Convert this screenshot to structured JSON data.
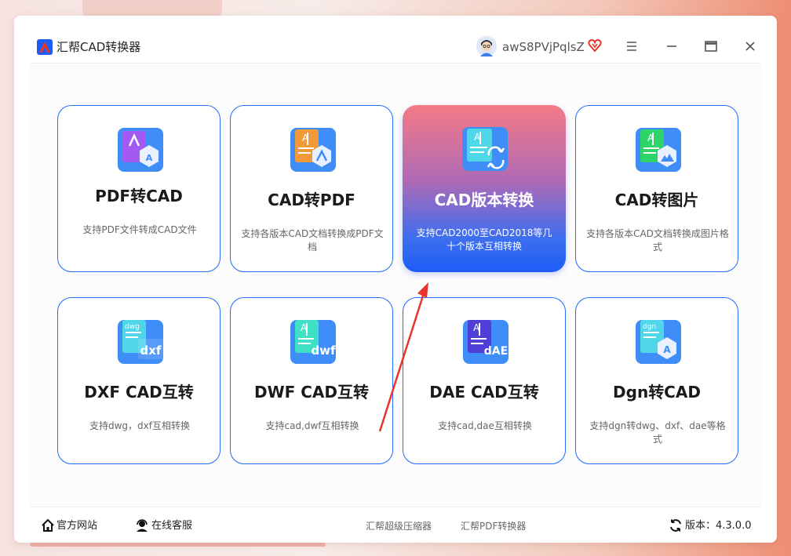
{
  "window": {
    "title": "汇帮CAD转换器"
  },
  "user": {
    "name": "awS8PVjPqlsZ"
  },
  "cards": [
    {
      "title": "PDF转CAD",
      "desc": "支持PDF文件转成CAD文件"
    },
    {
      "title": "CAD转PDF",
      "desc": "支持各版本CAD文档转换成PDF文档"
    },
    {
      "title": "CAD版本转换",
      "desc": "支持CAD2000至CAD2018等几十个版本互相转换"
    },
    {
      "title": "CAD转图片",
      "desc": "支持各版本CAD文档转换成图片格式"
    },
    {
      "title": "DXF CAD互转",
      "desc": "支持dwg，dxf互相转换"
    },
    {
      "title": "DWF CAD互转",
      "desc": "支持cad,dwf互相转换"
    },
    {
      "title": "DAE CAD互转",
      "desc": "支持cad,dae互相转换"
    },
    {
      "title": "Dgn转CAD",
      "desc": "支持dgn转dwg、dxf、dae等格式"
    }
  ],
  "icon_labels": {
    "dxf": "dxf",
    "dwf": "dwf",
    "dae": "dAE",
    "dgn": "dgn",
    "dwg": "dwg",
    "a": "A"
  },
  "footer": {
    "website": "官方网站",
    "support": "在线客服",
    "compressor": "汇帮超级压缩器",
    "pdf_converter": "汇帮PDF转换器",
    "version": "版本：4.3.0.0"
  },
  "colors": {
    "accent": "#1f6bff",
    "arrow": "#e8352b"
  }
}
